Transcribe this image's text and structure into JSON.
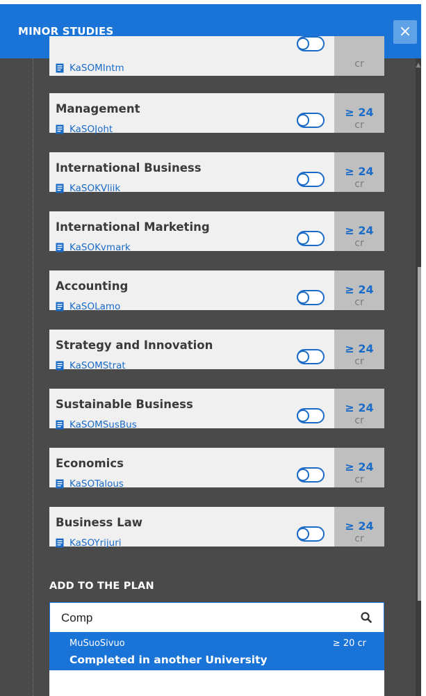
{
  "header": {
    "title": "MINOR STUDIES",
    "close_glyph": "×"
  },
  "minors": [
    {
      "name": "",
      "code": "KaSOMIntm",
      "credits": "",
      "unit": "cr"
    },
    {
      "name": "Management",
      "code": "KaSOJoht",
      "credits": "≥ 24",
      "unit": "cr"
    },
    {
      "name": "International Business",
      "code": "KaSOKVliik",
      "credits": "≥ 24",
      "unit": "cr"
    },
    {
      "name": "International Marketing",
      "code": "KaSOKvmark",
      "credits": "≥ 24",
      "unit": "cr"
    },
    {
      "name": "Accounting",
      "code": "KaSOLamo",
      "credits": "≥ 24",
      "unit": "cr"
    },
    {
      "name": "Strategy and Innovation",
      "code": "KaSOMStrat",
      "credits": "≥ 24",
      "unit": "cr"
    },
    {
      "name": "Sustainable Business",
      "code": "KaSOMSusBus",
      "credits": "≥ 24",
      "unit": "cr"
    },
    {
      "name": "Economics",
      "code": "KaSOTalous",
      "credits": "≥ 24",
      "unit": "cr"
    },
    {
      "name": "Business Law",
      "code": "KaSOYrijuri",
      "credits": "≥ 24",
      "unit": "cr"
    }
  ],
  "add_to_plan": {
    "label": "ADD TO THE PLAN",
    "search_value": "Comp",
    "result": {
      "code": "MuSuoSivuo",
      "credits": "≥ 20 cr",
      "title": "Completed in another University"
    }
  },
  "colors": {
    "accent": "#1a73d6",
    "panel": "#4a4a4a",
    "credit_bg": "#bfbfbf"
  }
}
